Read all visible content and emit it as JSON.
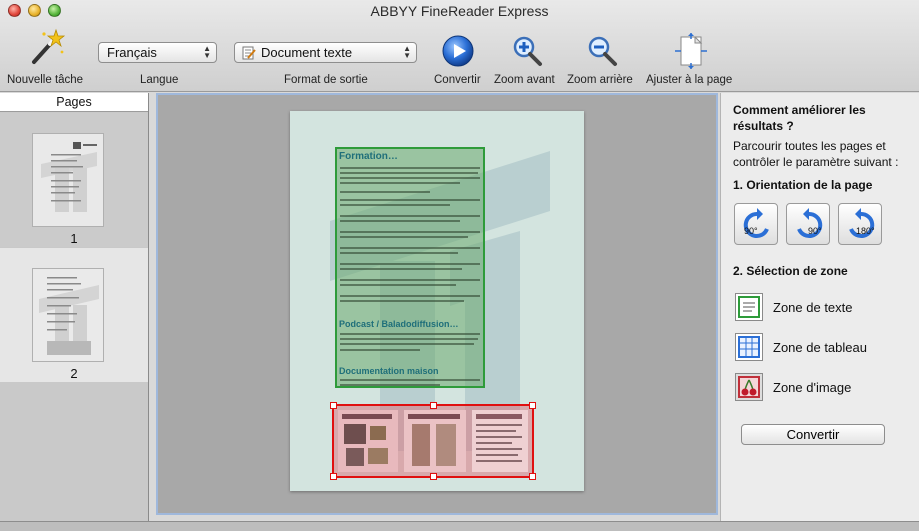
{
  "window": {
    "title": "ABBYY FineReader Express"
  },
  "toolbar": {
    "new_task_label": "Nouvelle tâche",
    "language_label": "Langue",
    "language_value": "Français",
    "output_format_label": "Format de sortie",
    "output_format_value": "Document texte",
    "convert_label": "Convertir",
    "zoom_in_label": "Zoom avant",
    "zoom_out_label": "Zoom arrière",
    "fit_page_label": "Ajuster à la page"
  },
  "sidebar": {
    "header": "Pages",
    "pages": [
      {
        "number": "1"
      },
      {
        "number": "2"
      }
    ]
  },
  "document": {
    "text_zone_headings": [
      "Formation…",
      "Podcast / Baladodiffusion…",
      "Documentation maison"
    ]
  },
  "panel": {
    "title": "Comment améliorer les résultats ?",
    "description": "Parcourir toutes les pages et contrôler le paramètre suivant :",
    "orientation_heading": "1. Orientation de la page",
    "rotations": [
      "90°",
      "90°",
      "180°"
    ],
    "zone_heading": "2. Sélection de zone",
    "zones": [
      "Zone de texte",
      "Zone de tableau",
      "Zone d'image"
    ],
    "convert_button": "Convertir"
  },
  "colors": {
    "text_zone_border": "#2e9b3a",
    "image_zone_border": "#e01010",
    "selection_border": "#9fb8dc"
  }
}
